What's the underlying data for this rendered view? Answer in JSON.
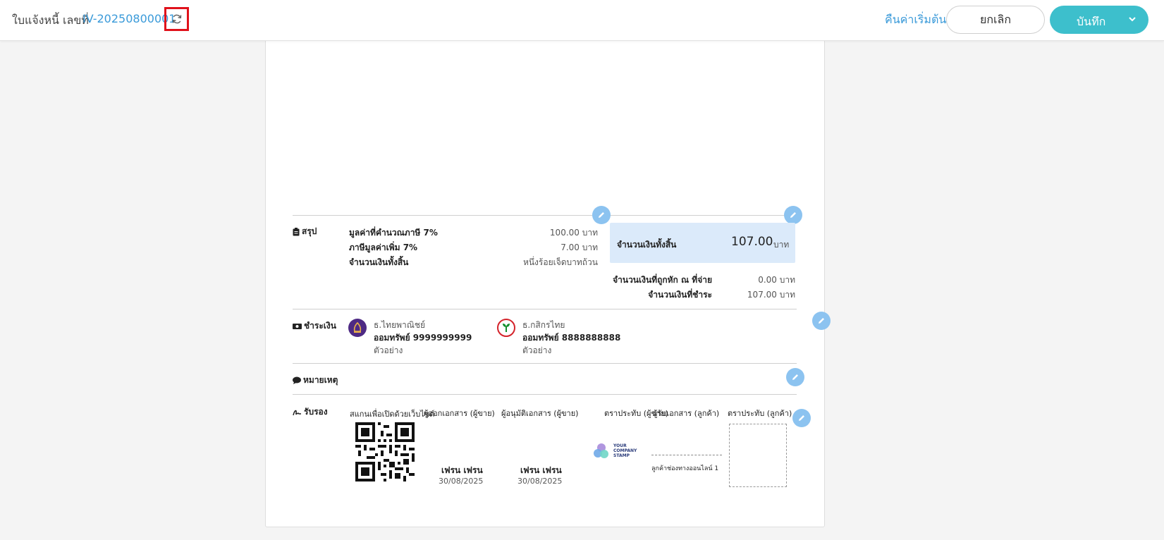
{
  "header": {
    "doc_label": "ใบแจ้งหนี้ เลขที่",
    "doc_number": "IV-20250800001",
    "reset_label": "คืนค่าเริ่มต้น",
    "cancel_label": "ยกเลิก",
    "save_label": "บันทึก"
  },
  "summary": {
    "title": "สรุป",
    "rows": [
      {
        "label": "มูลค่าที่คำนวณภาษี 7%",
        "value": "100.00 บาท"
      },
      {
        "label": "ภาษีมูลค่าเพิ่ม 7%",
        "value": "7.00 บาท"
      },
      {
        "label": "จำนวนเงินทั้งสิ้น",
        "value": "หนึ่งร้อยเจ็ดบาทถ้วน"
      }
    ],
    "total_label": "จำนวนเงินทั้งสิ้น",
    "total_amount": "107.00",
    "total_unit": "บาท",
    "withholding_label": "จำนวนเงินที่ถูกหัก ณ ที่จ่าย",
    "withholding_value": "0.00 บาท",
    "payable_label": "จำนวนเงินที่ชำระ",
    "payable_value": "107.00 บาท"
  },
  "payment": {
    "title": "ชำระเงิน",
    "banks": [
      {
        "name": "ธ.ไทยพาณิชย์",
        "account": "ออมทรัพย์ 9999999999",
        "note": "ตัวอย่าง",
        "color": "#4e2a84"
      },
      {
        "name": "ธ.กสิกรไทย",
        "account": "ออมทรัพย์ 8888888888",
        "note": "ตัวอย่าง",
        "color": "#138f2d"
      }
    ]
  },
  "remark": {
    "title": "หมายเหตุ"
  },
  "approval": {
    "title": "รับรอง",
    "qr_caption": "สแกนเพื่อเปิดด้วยเว็บไซต์",
    "columns": [
      "ผู้ออกเอกสาร (ผู้ขาย)",
      "ผู้อนุมัติเอกสาร (ผู้ขาย)",
      "ตราประทับ (ผู้ขาย)",
      "ผู้รับเอกสาร (ลูกค้า)",
      "ตราประทับ (ลูกค้า)"
    ],
    "issuer_name": "เฟรน เฟรน",
    "issuer_date": "30/08/2025",
    "approver_name": "เฟรน เฟรน",
    "approver_date": "30/08/2025",
    "stamp_text_1": "YOUR",
    "stamp_text_2": "COMPANY",
    "stamp_text_3": "STAMP",
    "receiver_name": "ลูกค้าช่องทางออนไลน์ 1"
  },
  "colors": {
    "accent": "#3dbfcc",
    "link": "#3a9ad9",
    "highlight": "#dbeafa",
    "pen": "#8cc3f0",
    "focus": "#e0121b"
  }
}
